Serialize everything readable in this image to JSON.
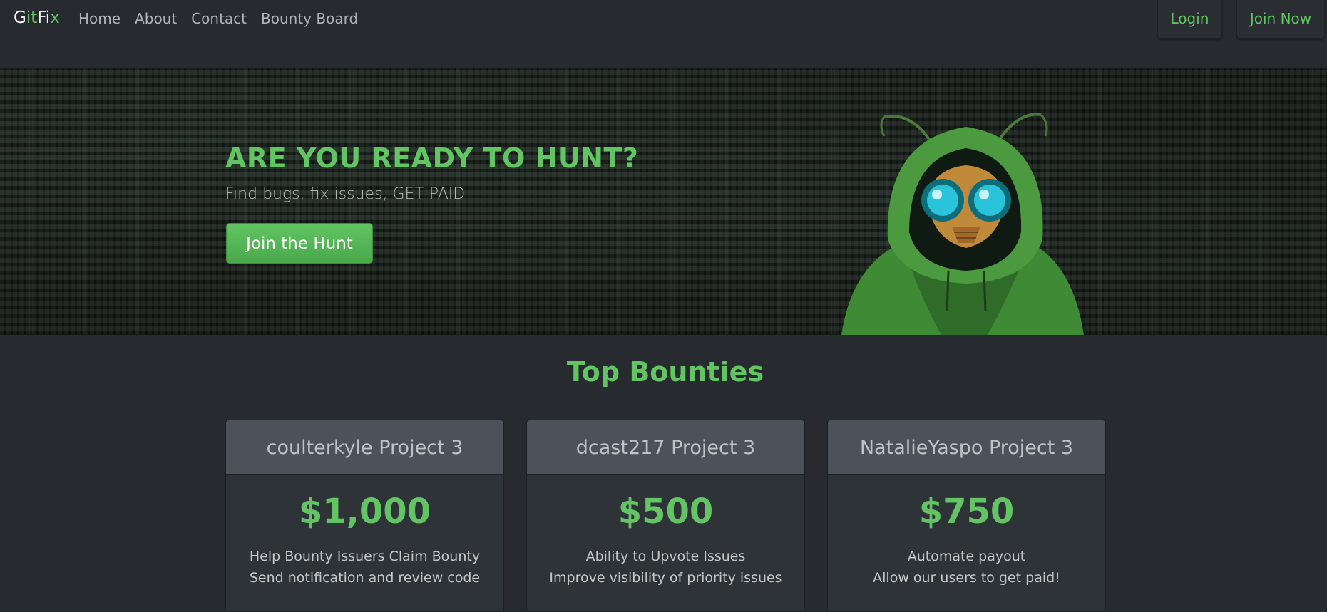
{
  "navbar": {
    "brand_prefix": "G",
    "brand_mid": "it",
    "brand_f": "Fi",
    "brand_suffix": "x",
    "links": [
      "Home",
      "About",
      "Contact",
      "Bounty Board"
    ],
    "login_label": "Login",
    "join_label": "Join Now"
  },
  "hero": {
    "title": "ARE YOU READY TO HUNT?",
    "subtitle": "Find bugs, fix issues, GET PAID",
    "cta_label": "Join the Hunt"
  },
  "bounties": {
    "title": "Top Bounties",
    "cards": [
      {
        "name": "coulterkyle Project 3",
        "amount": "$1,000",
        "line1": "Help Bounty Issuers Claim Bounty",
        "line2": "Send notification and review code"
      },
      {
        "name": "dcast217 Project 3",
        "amount": "$500",
        "line1": "Ability to Upvote Issues",
        "line2": "Improve visibility of priority issues"
      },
      {
        "name": "NatalieYaspo Project 3",
        "amount": "$750",
        "line1": "Automate payout",
        "line2": "Allow our users to get paid!"
      }
    ]
  },
  "colors": {
    "accent": "#62c462",
    "background": "#272b30",
    "card_header": "#4c5259"
  },
  "icons": {
    "mascot": "hooded-bug-hacker-illustration"
  }
}
